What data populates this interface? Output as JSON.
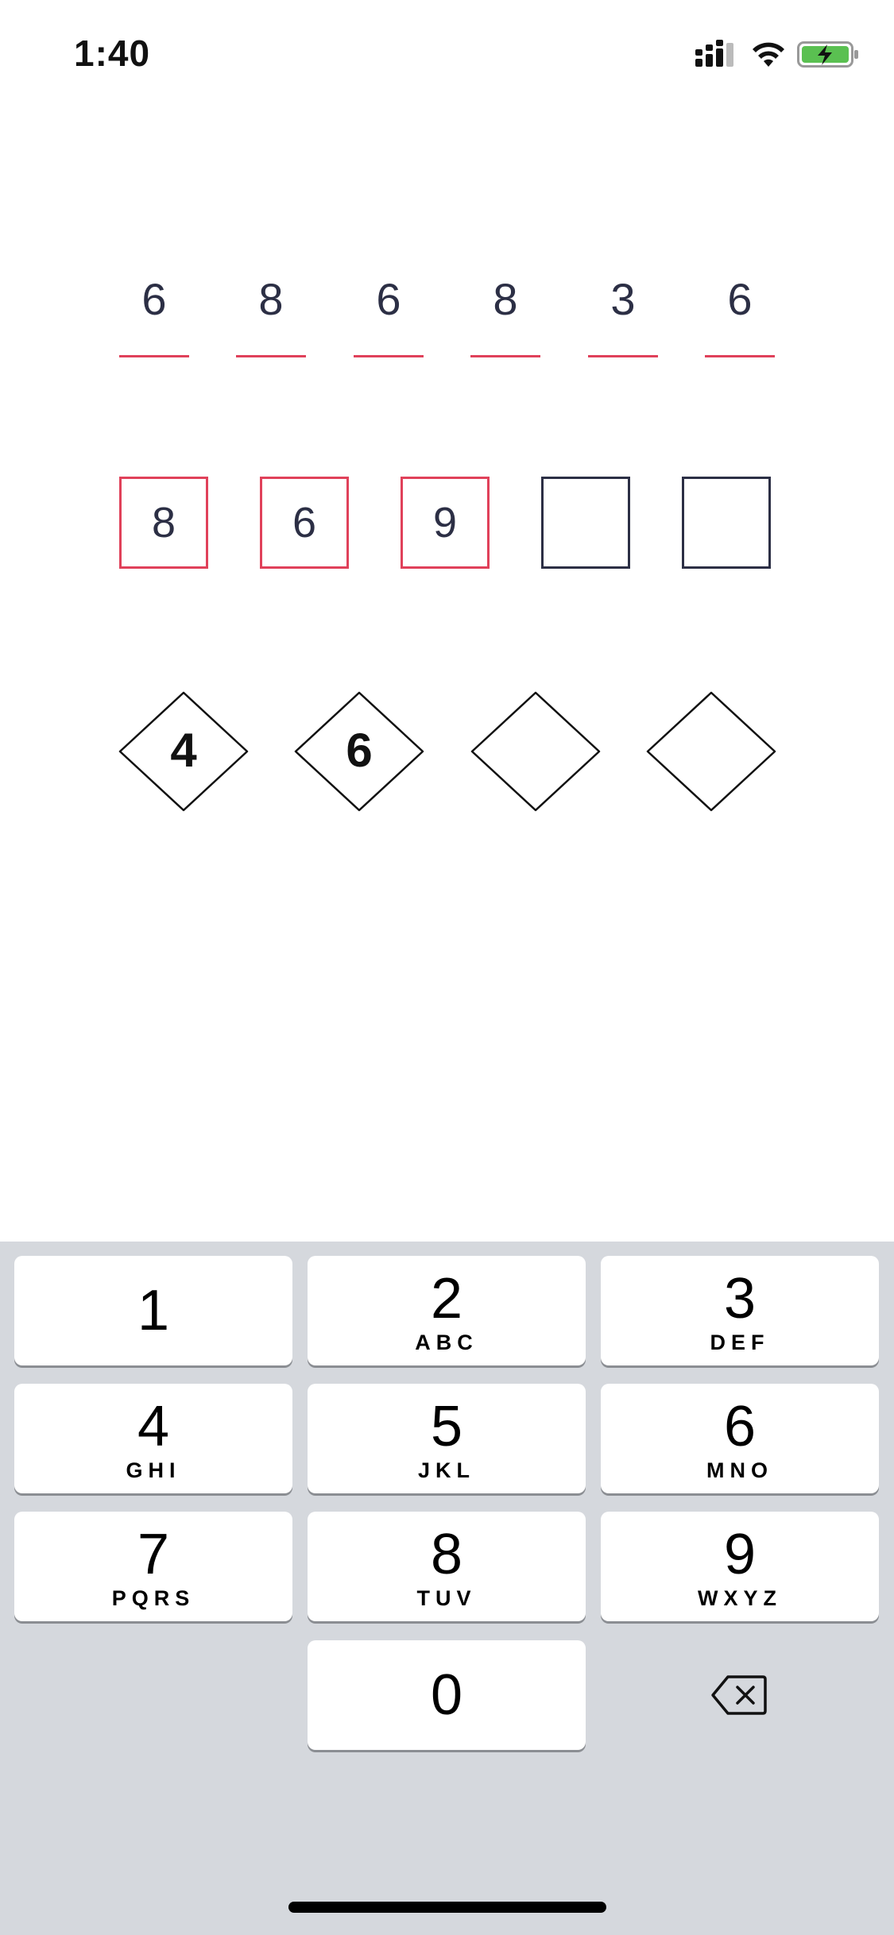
{
  "status_bar": {
    "time": "1:40",
    "icons": [
      "cellular-signal-icon",
      "wifi-icon",
      "battery-charging-icon"
    ],
    "battery_color": "#5ac051"
  },
  "underline_code": {
    "digits": [
      "6",
      "8",
      "6",
      "8",
      "3",
      "6"
    ],
    "accent_color": "#e0415a"
  },
  "box_code": {
    "digits": [
      "8",
      "6",
      "9",
      "",
      ""
    ],
    "filled_border_color": "#e0415a",
    "empty_border_color": "#2c2f45"
  },
  "diamond_code": {
    "digits": [
      "4",
      "6",
      "",
      ""
    ]
  },
  "keypad": {
    "keys": [
      {
        "number": "1",
        "letters": ""
      },
      {
        "number": "2",
        "letters": "ABC"
      },
      {
        "number": "3",
        "letters": "DEF"
      },
      {
        "number": "4",
        "letters": "GHI"
      },
      {
        "number": "5",
        "letters": "JKL"
      },
      {
        "number": "6",
        "letters": "MNO"
      },
      {
        "number": "7",
        "letters": "PQRS"
      },
      {
        "number": "8",
        "letters": "TUV"
      },
      {
        "number": "9",
        "letters": "WXYZ"
      },
      {
        "number": "0",
        "letters": ""
      }
    ],
    "delete_icon": "backspace-icon"
  }
}
